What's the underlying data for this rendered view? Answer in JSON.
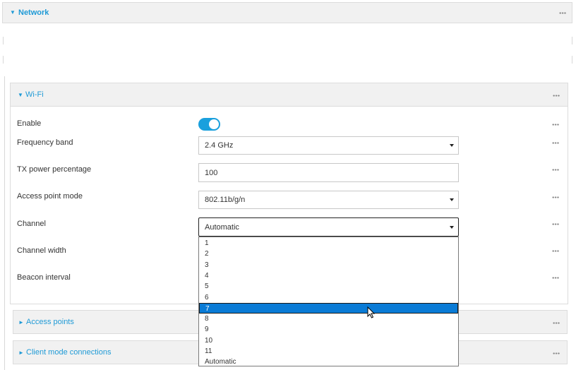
{
  "network": {
    "title": "Network",
    "arrow": "▼"
  },
  "wifi": {
    "title": "Wi-Fi",
    "arrow": "▼",
    "fields": {
      "enable": {
        "label": "Enable",
        "value": true
      },
      "frequency_band": {
        "label": "Frequency band",
        "value": "2.4 GHz"
      },
      "tx_power": {
        "label": "TX power percentage",
        "value": "100"
      },
      "ap_mode": {
        "label": "Access point mode",
        "value": "802.11b/g/n"
      },
      "channel": {
        "label": "Channel",
        "value": "Automatic"
      },
      "channel_width": {
        "label": "Channel width"
      },
      "beacon_interval": {
        "label": "Beacon interval"
      }
    }
  },
  "channel_options": [
    "1",
    "2",
    "3",
    "4",
    "5",
    "6",
    "7",
    "8",
    "9",
    "10",
    "11",
    "Automatic"
  ],
  "channel_selected_index": 6,
  "access_points": {
    "title": "Access points",
    "arrow": "►"
  },
  "client_mode": {
    "title": "Client mode connections",
    "arrow": "►"
  },
  "colors": {
    "accent": "#1f9ad6",
    "selection": "#0a7bd6"
  }
}
